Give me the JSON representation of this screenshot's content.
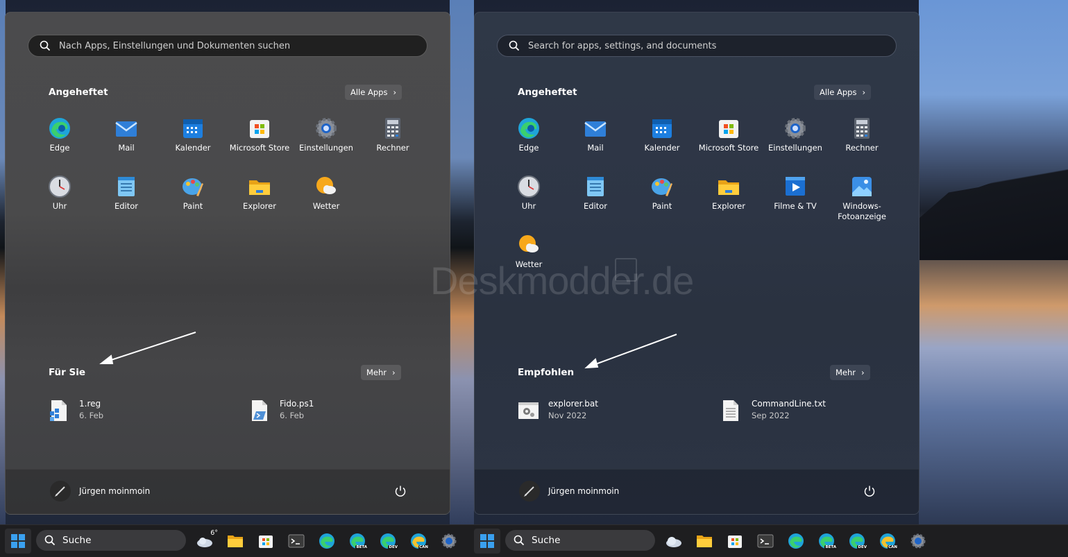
{
  "watermark": "Deskmodder.de",
  "left_menu": {
    "search_placeholder": "Nach Apps, Einstellungen und Dokumenten suchen",
    "pinned_title": "Angeheftet",
    "all_apps_label": "Alle Apps",
    "apps": [
      {
        "label": "Edge",
        "icon": "edge-icon"
      },
      {
        "label": "Mail",
        "icon": "mail-icon"
      },
      {
        "label": "Kalender",
        "icon": "calendar-icon"
      },
      {
        "label": "Microsoft Store",
        "icon": "store-icon"
      },
      {
        "label": "Einstellungen",
        "icon": "settings-icon"
      },
      {
        "label": "Rechner",
        "icon": "calculator-icon"
      },
      {
        "label": "Uhr",
        "icon": "clock-icon"
      },
      {
        "label": "Editor",
        "icon": "notepad-icon"
      },
      {
        "label": "Paint",
        "icon": "paint-icon"
      },
      {
        "label": "Explorer",
        "icon": "folder-icon"
      },
      {
        "label": "Wetter",
        "icon": "weather-icon"
      }
    ],
    "recommended_title": "Für Sie",
    "more_label": "Mehr",
    "recommended": [
      {
        "name": "1.reg",
        "date": "6. Feb",
        "icon": "reg-file-icon"
      },
      {
        "name": "Fido.ps1",
        "date": "6. Feb",
        "icon": "ps1-file-icon"
      }
    ],
    "user_name": "Jürgen moinmoin"
  },
  "right_menu": {
    "search_placeholder": "Search for apps, settings, and documents",
    "pinned_title": "Angeheftet",
    "all_apps_label": "Alle Apps",
    "apps": [
      {
        "label": "Edge",
        "icon": "edge-icon"
      },
      {
        "label": "Mail",
        "icon": "mail-icon"
      },
      {
        "label": "Kalender",
        "icon": "calendar-icon"
      },
      {
        "label": "Microsoft Store",
        "icon": "store-icon"
      },
      {
        "label": "Einstellungen",
        "icon": "settings-icon"
      },
      {
        "label": "Rechner",
        "icon": "calculator-icon"
      },
      {
        "label": "Uhr",
        "icon": "clock-icon"
      },
      {
        "label": "Editor",
        "icon": "notepad-icon"
      },
      {
        "label": "Paint",
        "icon": "paint-icon"
      },
      {
        "label": "Explorer",
        "icon": "folder-icon"
      },
      {
        "label": "Filme & TV",
        "icon": "movies-icon"
      },
      {
        "label": "Windows-Fotoanzeige",
        "icon": "photos-icon"
      },
      {
        "label": "Wetter",
        "icon": "weather-icon"
      }
    ],
    "recommended_title": "Empfohlen",
    "more_label": "Mehr",
    "recommended": [
      {
        "name": "explorer.bat",
        "date": "Nov 2022",
        "icon": "bat-file-icon"
      },
      {
        "name": "CommandLine.txt",
        "date": "Sep 2022",
        "icon": "txt-file-icon"
      }
    ],
    "user_name": "Jürgen moinmoin"
  },
  "taskbar": {
    "search_label": "Suche",
    "weather_temp": "6°",
    "badges": {
      "beta": "BETA",
      "dev": "DEV",
      "can": "CAN"
    }
  }
}
